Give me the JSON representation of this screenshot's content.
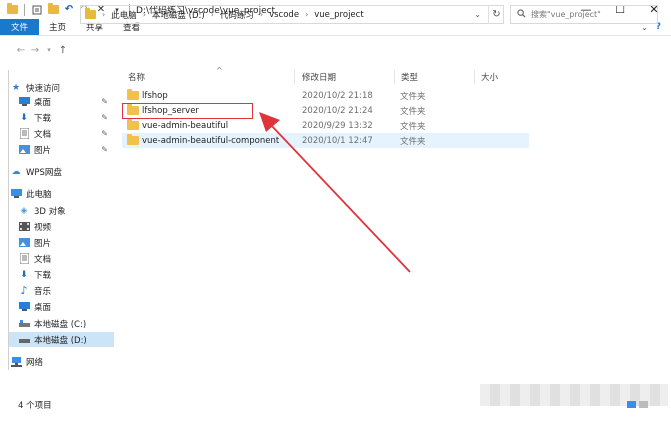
{
  "window": {
    "title": "D:\\代码练习\\vscode\\vue_project",
    "controls": {
      "minimize": "—",
      "maximize": "☐",
      "close": "✕"
    }
  },
  "ribbon": {
    "tabs": [
      {
        "label": "文件",
        "active": true
      },
      {
        "label": "主页",
        "active": false
      },
      {
        "label": "共享",
        "active": false
      },
      {
        "label": "查看",
        "active": false
      }
    ],
    "accent": "#1979ca"
  },
  "address": {
    "crumbs": [
      "此电脑",
      "本地磁盘 (D:)",
      "代码练习",
      "vscode",
      "vue_project"
    ]
  },
  "search": {
    "placeholder": "搜索\"vue_project\""
  },
  "sidebar": {
    "items": [
      {
        "label": "快速访问",
        "icon": "star-icon",
        "pinned": false,
        "selected": false
      },
      {
        "label": "桌面",
        "icon": "desktop-icon",
        "pinned": true,
        "selected": false
      },
      {
        "label": "下载",
        "icon": "download-icon",
        "pinned": true,
        "selected": false
      },
      {
        "label": "文档",
        "icon": "document-icon",
        "pinned": true,
        "selected": false
      },
      {
        "label": "图片",
        "icon": "picture-icon",
        "pinned": true,
        "selected": false
      },
      {
        "label": "WPS网盘",
        "icon": "cloud-icon",
        "pinned": false,
        "selected": false
      },
      {
        "label": "此电脑",
        "icon": "computer-icon",
        "pinned": false,
        "selected": false
      },
      {
        "label": "3D 对象",
        "icon": "cube-icon",
        "pinned": false,
        "selected": false
      },
      {
        "label": "视频",
        "icon": "video-icon",
        "pinned": false,
        "selected": false
      },
      {
        "label": "图片",
        "icon": "picture-icon",
        "pinned": false,
        "selected": false
      },
      {
        "label": "文档",
        "icon": "document-icon",
        "pinned": false,
        "selected": false
      },
      {
        "label": "下载",
        "icon": "download-icon",
        "pinned": false,
        "selected": false
      },
      {
        "label": "音乐",
        "icon": "music-icon",
        "pinned": false,
        "selected": false
      },
      {
        "label": "桌面",
        "icon": "desktop-icon",
        "pinned": false,
        "selected": false
      },
      {
        "label": "本地磁盘 (C:)",
        "icon": "drive-icon",
        "pinned": false,
        "selected": false
      },
      {
        "label": "本地磁盘 (D:)",
        "icon": "drive-icon",
        "pinned": false,
        "selected": true
      },
      {
        "label": "网络",
        "icon": "network-icon",
        "pinned": false,
        "selected": false
      }
    ]
  },
  "list": {
    "columns": {
      "name": "名称",
      "date": "修改日期",
      "type": "类型",
      "size": "大小"
    },
    "rows": [
      {
        "name": "lfshop",
        "date": "2020/10/2 21:18",
        "type": "文件夹",
        "highlighted": false
      },
      {
        "name": "lfshop_server",
        "date": "2020/10/2 21:24",
        "type": "文件夹",
        "highlighted": false,
        "annotated": true
      },
      {
        "name": "vue-admin-beautiful",
        "date": "2020/9/29 13:32",
        "type": "文件夹",
        "highlighted": false
      },
      {
        "name": "vue-admin-beautiful-component",
        "date": "2020/10/1 12:47",
        "type": "文件夹",
        "highlighted": true
      }
    ]
  },
  "status": {
    "count": "4 个项目"
  },
  "annotation": {
    "color": "#e0343c"
  }
}
